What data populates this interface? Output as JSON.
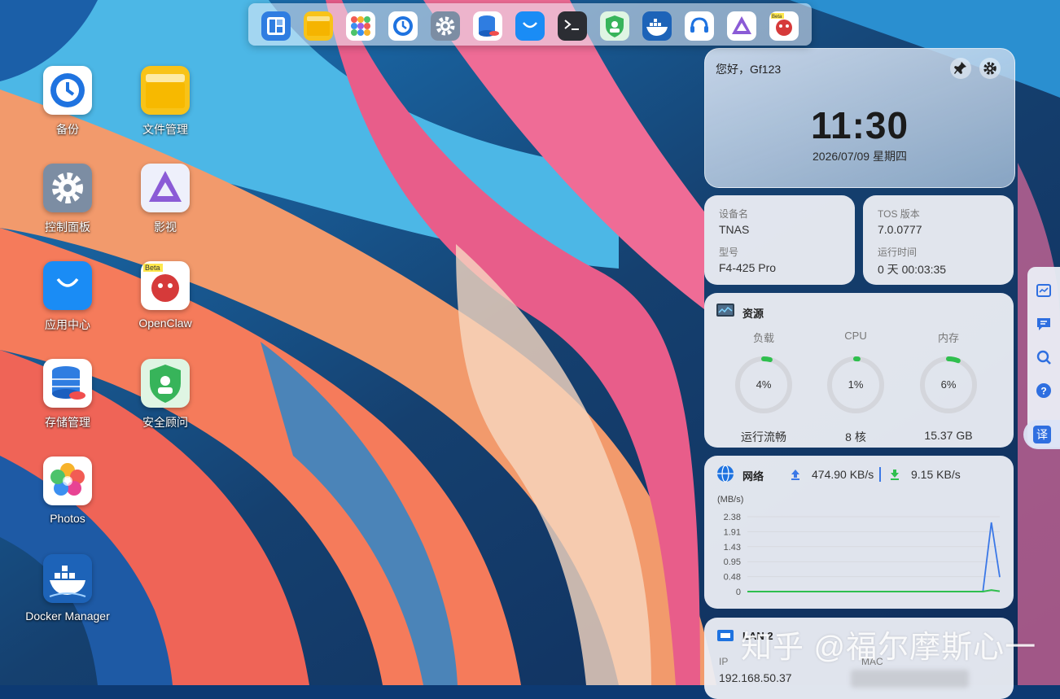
{
  "dock": {
    "items": [
      {
        "name": "desktop-layout"
      },
      {
        "name": "file-manager"
      },
      {
        "name": "app-grid"
      },
      {
        "name": "backup"
      },
      {
        "name": "control-panel"
      },
      {
        "name": "storage-manager"
      },
      {
        "name": "app-center"
      },
      {
        "name": "terminal"
      },
      {
        "name": "security-advisor"
      },
      {
        "name": "docker-manager"
      },
      {
        "name": "support"
      },
      {
        "name": "jellyfin-media"
      },
      {
        "name": "openclaw",
        "badge": "Beta"
      }
    ]
  },
  "desktop": {
    "icons": [
      {
        "label": "备份",
        "icon": "backup-icon"
      },
      {
        "label": "文件管理",
        "icon": "folder-icon"
      },
      {
        "label": "控制面板",
        "icon": "gear-icon"
      },
      {
        "label": "影视",
        "icon": "media-icon"
      },
      {
        "label": "应用中心",
        "icon": "shopping-bag-icon"
      },
      {
        "label": "OpenClaw",
        "icon": "openclaw-icon",
        "badge": "Beta"
      },
      {
        "label": "存储管理",
        "icon": "storage-icon"
      },
      {
        "label": "安全顾问",
        "icon": "shield-icon"
      },
      {
        "label": "Photos",
        "icon": "photos-icon"
      },
      {
        "label": "Docker Manager",
        "icon": "docker-icon"
      }
    ]
  },
  "clock": {
    "greeting": "您好，Gf123",
    "time": "11:30",
    "date": "2026/07/09 星期四"
  },
  "device": {
    "name_label": "设备名",
    "name_value": "TNAS",
    "model_label": "型号",
    "model_value": "F4-425 Pro"
  },
  "system": {
    "tos_label": "TOS 版本",
    "tos_value": "7.0.0777",
    "uptime_label": "运行时间",
    "uptime_value": "0 天 00:03:35"
  },
  "resources": {
    "title": "资源",
    "gauges": [
      {
        "label": "负载",
        "percent": 4,
        "value_text": "4%",
        "sub": "运行流畅"
      },
      {
        "label": "CPU",
        "percent": 1,
        "value_text": "1%",
        "sub": "8 核"
      },
      {
        "label": "内存",
        "percent": 6,
        "value_text": "6%",
        "sub": "15.37 GB"
      }
    ],
    "accent": "#2fbf4e",
    "track": "#d4d6dc"
  },
  "network": {
    "title": "网络",
    "upload": "474.90 KB/s",
    "download": "9.15 KB/s",
    "unit_label": "(MB/s)",
    "upload_color": "#3b78e7",
    "download_color": "#2fbf4e"
  },
  "chart_data": {
    "type": "line",
    "ylabel": "(MB/s)",
    "yticks": [
      "2.38",
      "1.91",
      "1.43",
      "0.95",
      "0.48",
      "0"
    ],
    "ylim": [
      0,
      2.38
    ],
    "grid": true,
    "series": [
      {
        "values": [
          0,
          0,
          0,
          0,
          0,
          0,
          0,
          0,
          0,
          0,
          0,
          0,
          0,
          0,
          0,
          0,
          0,
          0,
          0,
          0,
          0,
          0,
          0,
          0,
          0,
          0,
          0,
          0,
          0,
          2.2,
          0.46
        ],
        "color": "#3b78e7"
      },
      {
        "values": [
          0,
          0,
          0,
          0,
          0,
          0,
          0,
          0,
          0,
          0,
          0,
          0,
          0,
          0,
          0,
          0,
          0,
          0,
          0,
          0,
          0,
          0,
          0,
          0,
          0,
          0,
          0,
          0,
          0,
          0.05,
          0.01
        ],
        "color": "#2fbf4e"
      }
    ]
  },
  "lan": {
    "title": "LAN 2",
    "ip_label": "IP",
    "ip_value": "192.168.50.37",
    "mac_label": "MAC"
  },
  "sidebar": {
    "items": [
      {
        "icon": "activity-monitor-icon"
      },
      {
        "icon": "message-icon"
      },
      {
        "icon": "search-icon"
      },
      {
        "icon": "help-icon"
      }
    ],
    "translate_label": "译"
  },
  "watermark": "知乎 @福尔摩斯心一"
}
